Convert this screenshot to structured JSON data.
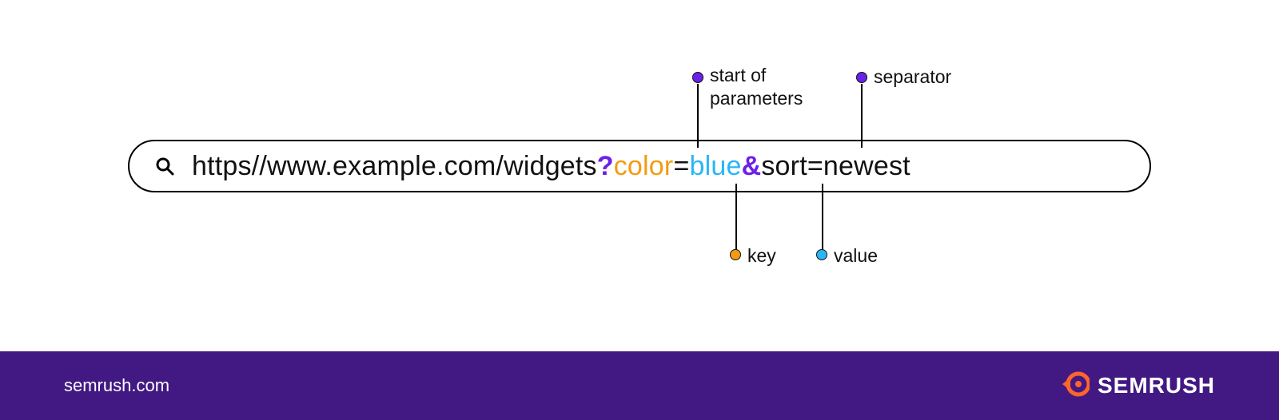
{
  "url": {
    "base": "https//www.example.com/widgets",
    "qmark": "?",
    "key1": "color",
    "eq1": "=",
    "val1": "blue",
    "sep": "&",
    "key2": "sort",
    "eq2": "=",
    "val2": "newest"
  },
  "annotations": {
    "start_of_parameters_l1": "start of",
    "start_of_parameters_l2": "parameters",
    "separator": "separator",
    "key": "key",
    "value": "value"
  },
  "colors": {
    "purple": "#6b21e8",
    "orange": "#f39c12",
    "blue": "#29b6f6",
    "footer_bg": "#421983",
    "brand_orange": "#ff642d"
  },
  "footer": {
    "site": "semrush.com",
    "brand": "SEMRUSH"
  }
}
